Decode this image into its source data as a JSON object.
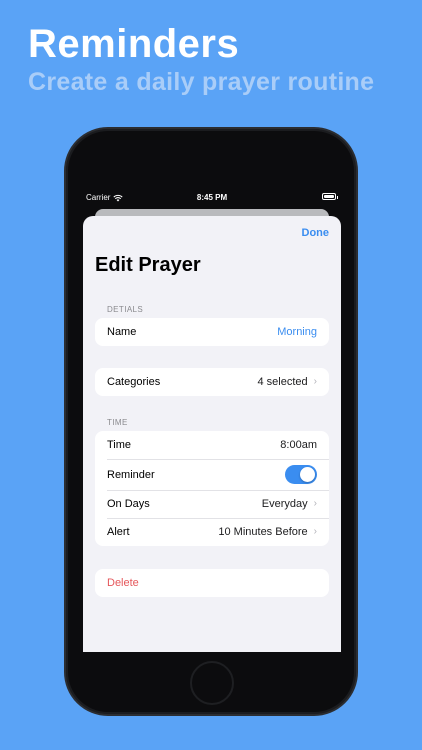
{
  "promo": {
    "headline": "Reminders",
    "subheadline": "Create a daily prayer routine"
  },
  "statusbar": {
    "carrier": "Carrier",
    "time": "8:45 PM"
  },
  "sheet": {
    "done_label": "Done",
    "title": "Edit Prayer",
    "details_header": "DETIALS",
    "name_label": "Name",
    "name_value": "Morning",
    "categories_label": "Categories",
    "categories_value": "4 selected",
    "time_header": "TIME",
    "time_label": "Time",
    "time_value": "8:00am",
    "reminder_label": "Reminder",
    "reminder_on": true,
    "on_days_label": "On Days",
    "on_days_value": "Everyday",
    "alert_label": "Alert",
    "alert_value": "10 Minutes Before",
    "delete_label": "Delete"
  },
  "colors": {
    "background": "#5aa3f6",
    "accent": "#3a8df0",
    "destructive": "#e5575b"
  }
}
